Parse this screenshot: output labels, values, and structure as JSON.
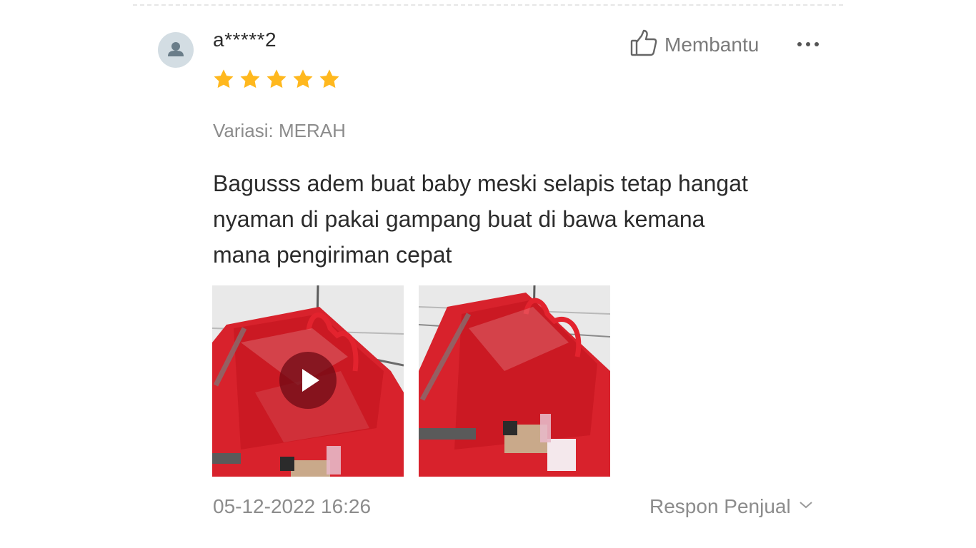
{
  "review": {
    "username": "a*****2",
    "rating": 5,
    "rating_max": 5,
    "helpful_label": "Membantu",
    "variation": "Variasi: MERAH",
    "text_lines": [
      "Bagusss adem buat baby meski selapis tetap hangat",
      "nyaman di pakai gampang buat di bawa kemana",
      "mana pengiriman cepat"
    ],
    "timestamp": "05-12-2022 16:26",
    "seller_reply_label": "Respon Penjual"
  },
  "icons": {
    "avatar": "user-icon",
    "helpful": "thumbs-up-icon",
    "more": "more-horizontal-icon",
    "play": "play-icon",
    "seller_reply": "chevron-down-icon"
  },
  "colors": {
    "star": "#FFB81E",
    "text_primary": "#2b2b2b",
    "text_secondary": "#8c8c8c",
    "avatar_bg": "#d3dde3",
    "avatar_fg": "#6a7d89"
  }
}
